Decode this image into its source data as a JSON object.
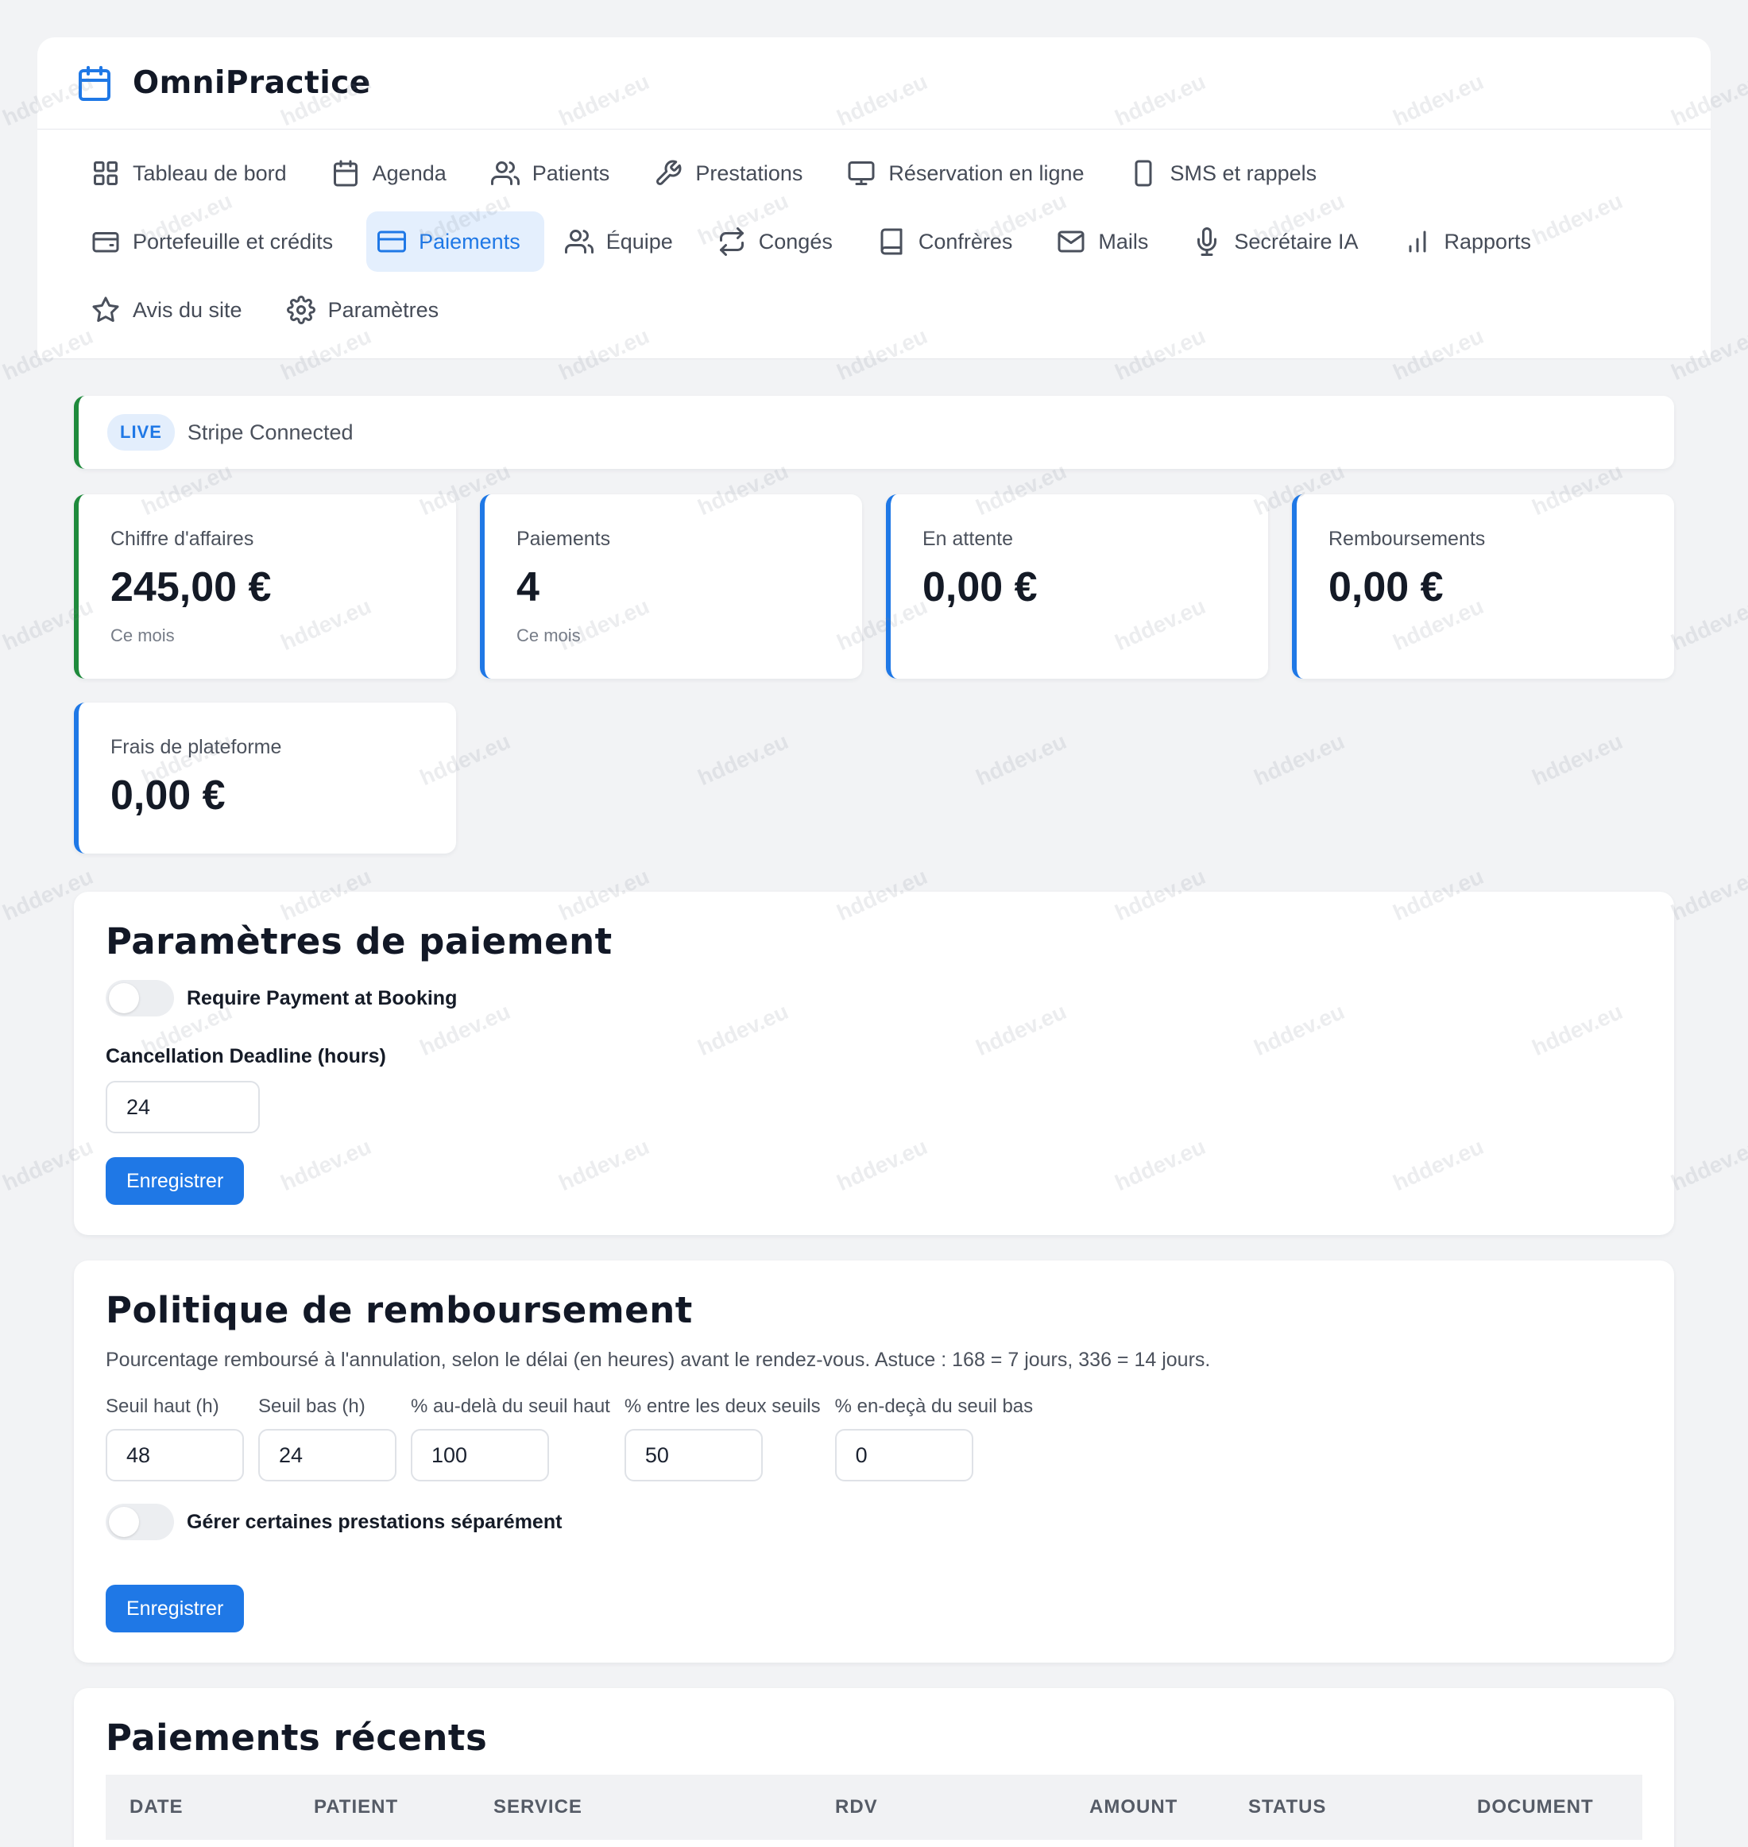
{
  "app": {
    "name": "OmniPractice",
    "logo_icon": "calendar-icon",
    "accent": "#1f78e6"
  },
  "nav": {
    "rows": [
      [
        {
          "label": "Tableau de bord",
          "icon": "grid-icon",
          "active": false
        },
        {
          "label": "Agenda",
          "icon": "calendar-icon",
          "active": false
        },
        {
          "label": "Patients",
          "icon": "users-icon",
          "active": false
        },
        {
          "label": "Prestations",
          "icon": "wrench-icon",
          "active": false
        },
        {
          "label": "Réservation en ligne",
          "icon": "monitor-icon",
          "active": false
        },
        {
          "label": "SMS et rappels",
          "icon": "smartphone-icon",
          "active": false
        }
      ],
      [
        {
          "label": "Portefeuille et crédits",
          "icon": "wallet-icon",
          "active": false
        },
        {
          "label": "Paiements",
          "icon": "credit-card-icon",
          "active": true
        },
        {
          "label": "Équipe",
          "icon": "team-icon",
          "active": false
        },
        {
          "label": "Congés",
          "icon": "repeat-icon",
          "active": false
        },
        {
          "label": "Confrères",
          "icon": "book-icon",
          "active": false
        },
        {
          "label": "Mails",
          "icon": "mail-icon",
          "active": false
        },
        {
          "label": "Secrétaire IA",
          "icon": "microphone-icon",
          "active": false
        },
        {
          "label": "Rapports",
          "icon": "bar-chart-icon",
          "active": false
        }
      ],
      [
        {
          "label": "Avis du site",
          "icon": "star-icon",
          "active": false
        },
        {
          "label": "Paramètres",
          "icon": "settings-icon",
          "active": false
        }
      ]
    ]
  },
  "stripe": {
    "badge": "LIVE",
    "status": "Stripe Connected",
    "status_color": "#1f8a3c"
  },
  "stats": [
    {
      "label": "Chiffre d'affaires",
      "value": "245,00 €",
      "sub": "Ce mois",
      "color": "#1f8a3c"
    },
    {
      "label": "Paiements",
      "value": "4",
      "sub": "Ce mois",
      "color": "#1f78e6"
    },
    {
      "label": "En attente",
      "value": "0,00 €",
      "sub": "",
      "color": "#1f78e6"
    },
    {
      "label": "Remboursements",
      "value": "0,00 €",
      "sub": "",
      "color": "#1f78e6"
    },
    {
      "label": "Frais de plateforme",
      "value": "0,00 €",
      "sub": "",
      "color": "#1f78e6"
    }
  ],
  "payment_settings": {
    "title": "Paramètres de paiement",
    "require_payment_label": "Require Payment at Booking",
    "require_payment_on": false,
    "deadline_label": "Cancellation Deadline (hours)",
    "deadline_value": "24",
    "save_label": "Enregistrer"
  },
  "refund_policy": {
    "title": "Politique de remboursement",
    "description": "Pourcentage remboursé à l'annulation, selon le délai (en heures) avant le rendez-vous. Astuce : 168 = 7 jours, 336 = 14 jours.",
    "fields": [
      {
        "label": "Seuil haut (h)",
        "value": "48"
      },
      {
        "label": "Seuil bas (h)",
        "value": "24"
      },
      {
        "label": "% au-delà du seuil haut",
        "value": "100"
      },
      {
        "label": "% entre les deux seuils",
        "value": "50"
      },
      {
        "label": "% en-deçà du seuil bas",
        "value": "0"
      }
    ],
    "separate_label": "Gérer certaines prestations séparément",
    "separate_on": false,
    "save_label": "Enregistrer"
  },
  "recent_payments": {
    "title": "Paiements récents",
    "columns": [
      "DATE",
      "PATIENT",
      "SERVICE",
      "RDV",
      "AMOUNT",
      "STATUS",
      "DOCUMENT"
    ]
  },
  "watermark": "hddev.eu"
}
